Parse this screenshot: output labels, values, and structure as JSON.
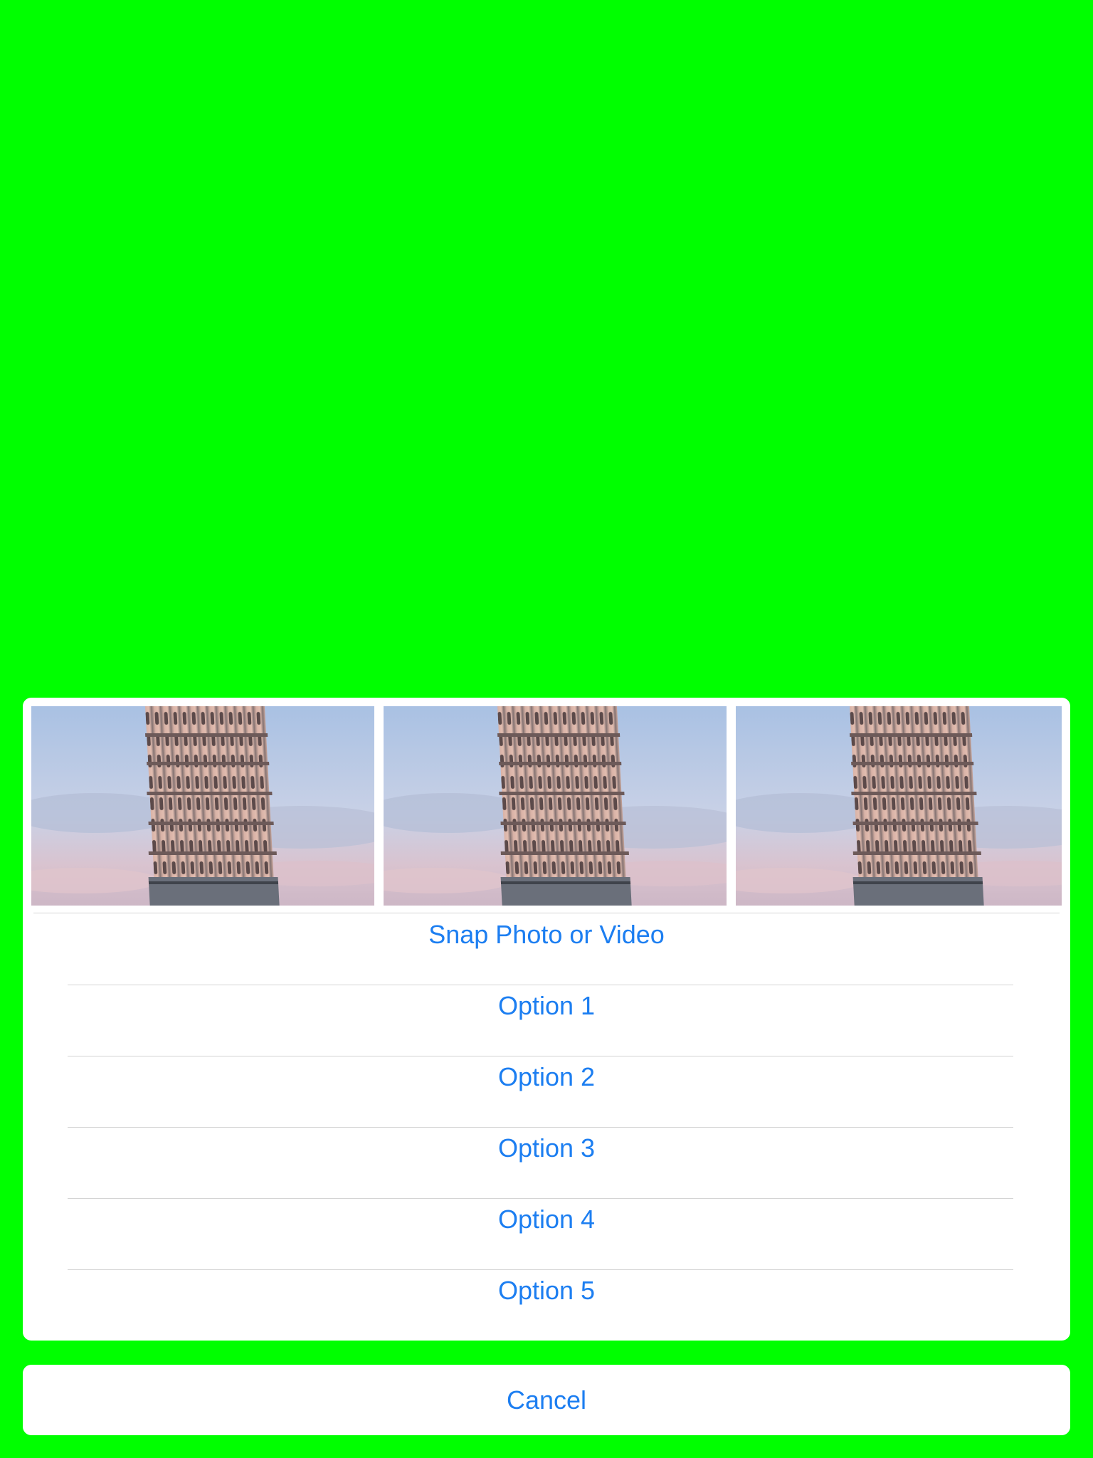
{
  "screen": {
    "background_color": "#00ff00"
  },
  "action_sheet": {
    "photo_strip": {
      "thumbnails": [
        {
          "icon": "leaning-tower-photo"
        },
        {
          "icon": "leaning-tower-photo"
        },
        {
          "icon": "leaning-tower-photo"
        }
      ]
    },
    "actions": [
      {
        "label": "Snap Photo or Video"
      },
      {
        "label": "Option 1"
      },
      {
        "label": "Option 2"
      },
      {
        "label": "Option 3"
      },
      {
        "label": "Option 4"
      },
      {
        "label": "Option 5"
      }
    ],
    "cancel_label": "Cancel",
    "tint_color": "#1c7ef1"
  }
}
